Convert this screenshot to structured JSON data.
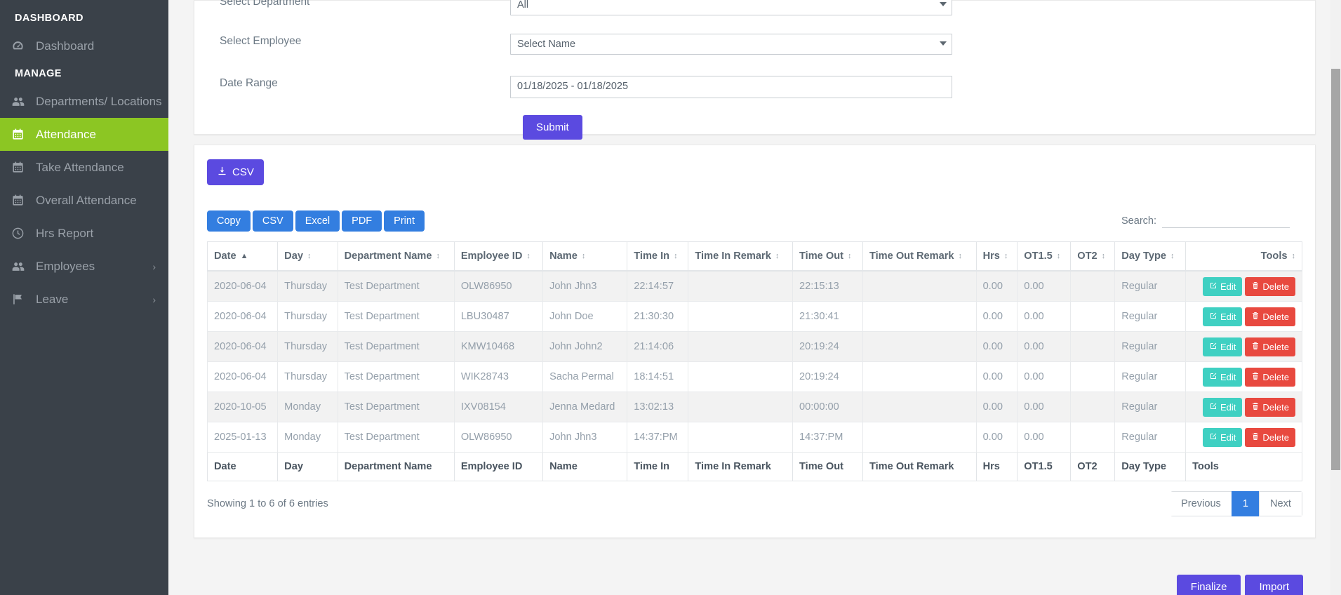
{
  "sidebar": {
    "sections": [
      {
        "label": "DASHBOARD"
      },
      {
        "label": "MANAGE"
      }
    ],
    "items": [
      {
        "label": "Dashboard",
        "icon": "gauge-icon",
        "active": false,
        "has_caret": false
      },
      {
        "label": "Departments/ Locations",
        "icon": "users-icon",
        "active": false,
        "has_caret": false
      },
      {
        "label": "Attendance",
        "icon": "calendar-icon",
        "active": true,
        "has_caret": false
      },
      {
        "label": "Take Attendance",
        "icon": "calendar-icon",
        "active": false,
        "has_caret": false
      },
      {
        "label": "Overall Attendance",
        "icon": "calendar-icon",
        "active": false,
        "has_caret": false
      },
      {
        "label": "Hrs Report",
        "icon": "clock-icon",
        "active": false,
        "has_caret": false
      },
      {
        "label": "Employees",
        "icon": "users-icon",
        "active": false,
        "has_caret": true
      },
      {
        "label": "Leave",
        "icon": "flag-icon",
        "active": false,
        "has_caret": true
      }
    ],
    "active_color": "#8cc623",
    "background": "#3a4149"
  },
  "filters": {
    "department": {
      "label": "Select Department",
      "value": "All"
    },
    "employee": {
      "label": "Select Employee",
      "value": "Select Name"
    },
    "date_range": {
      "label": "Date Range",
      "value": "01/18/2025 - 01/18/2025"
    },
    "submit_label": "Submit",
    "submit_color": "#5b4ae0"
  },
  "export": {
    "csv_label": "CSV",
    "csv_icon": "download-icon",
    "color": "#5b4ae0"
  },
  "datatable": {
    "buttons": [
      {
        "label": "Copy"
      },
      {
        "label": "CSV"
      },
      {
        "label": "Excel"
      },
      {
        "label": "PDF"
      },
      {
        "label": "Print"
      }
    ],
    "button_color": "#337ee0",
    "search": {
      "label": "Search:",
      "value": "",
      "placeholder": ""
    },
    "columns": [
      {
        "label": "Date",
        "sort": "asc"
      },
      {
        "label": "Day",
        "sort": "none"
      },
      {
        "label": "Department Name",
        "sort": "none"
      },
      {
        "label": "Employee ID",
        "sort": "none"
      },
      {
        "label": "Name",
        "sort": "none"
      },
      {
        "label": "Time In",
        "sort": "none"
      },
      {
        "label": "Time In Remark",
        "sort": "none"
      },
      {
        "label": "Time Out",
        "sort": "none"
      },
      {
        "label": "Time Out Remark",
        "sort": "none"
      },
      {
        "label": "Hrs",
        "sort": "none"
      },
      {
        "label": "OT1.5",
        "sort": "none"
      },
      {
        "label": "OT2",
        "sort": "none"
      },
      {
        "label": "Day Type",
        "sort": "none"
      },
      {
        "label": "Tools",
        "sort": "none"
      }
    ],
    "rows": [
      {
        "date": "2020-06-04",
        "day": "Thursday",
        "department": "Test Department",
        "employee_id": "OLW86950",
        "name": "John Jhn3",
        "time_in": "22:14:57",
        "time_in_remark": "",
        "time_out": "22:15:13",
        "time_out_remark": "",
        "hrs": "0.00",
        "ot15": "0.00",
        "ot2": "",
        "day_type": "Regular"
      },
      {
        "date": "2020-06-04",
        "day": "Thursday",
        "department": "Test Department",
        "employee_id": "LBU30487",
        "name": "John Doe",
        "time_in": "21:30:30",
        "time_in_remark": "",
        "time_out": "21:30:41",
        "time_out_remark": "",
        "hrs": "0.00",
        "ot15": "0.00",
        "ot2": "",
        "day_type": "Regular"
      },
      {
        "date": "2020-06-04",
        "day": "Thursday",
        "department": "Test Department",
        "employee_id": "KMW10468",
        "name": "John John2",
        "time_in": "21:14:06",
        "time_in_remark": "",
        "time_out": "20:19:24",
        "time_out_remark": "",
        "hrs": "0.00",
        "ot15": "0.00",
        "ot2": "",
        "day_type": "Regular"
      },
      {
        "date": "2020-06-04",
        "day": "Thursday",
        "department": "Test Department",
        "employee_id": "WIK28743",
        "name": "Sacha Permal",
        "time_in": "18:14:51",
        "time_in_remark": "",
        "time_out": "20:19:24",
        "time_out_remark": "",
        "hrs": "0.00",
        "ot15": "0.00",
        "ot2": "",
        "day_type": "Regular"
      },
      {
        "date": "2020-10-05",
        "day": "Monday",
        "department": "Test Department",
        "employee_id": "IXV08154",
        "name": "Jenna Medard",
        "time_in": "13:02:13",
        "time_in_remark": "",
        "time_out": "00:00:00",
        "time_out_remark": "",
        "hrs": "0.00",
        "ot15": "0.00",
        "ot2": "",
        "day_type": "Regular"
      },
      {
        "date": "2025-01-13",
        "day": "Monday",
        "department": "Test Department",
        "employee_id": "OLW86950",
        "name": "John Jhn3",
        "time_in": "14:37:PM",
        "time_in_remark": "",
        "time_out": "14:37:PM",
        "time_out_remark": "",
        "hrs": "0.00",
        "ot15": "0.00",
        "ot2": "",
        "day_type": "Regular"
      }
    ],
    "row_actions": {
      "edit_label": "Edit",
      "edit_icon": "pencil-square-icon",
      "edit_color": "#3fd0c2",
      "delete_label": "Delete",
      "delete_icon": "trash-icon",
      "delete_color": "#e8493f"
    },
    "info": "Showing 1 to 6 of 6 entries",
    "pagination": {
      "previous_label": "Previous",
      "next_label": "Next",
      "pages": [
        {
          "label": "1",
          "active": true
        }
      ],
      "active_color": "#337ee0"
    }
  },
  "bottom_actions": [
    {
      "label": "Finalize"
    },
    {
      "label": "Import"
    }
  ]
}
